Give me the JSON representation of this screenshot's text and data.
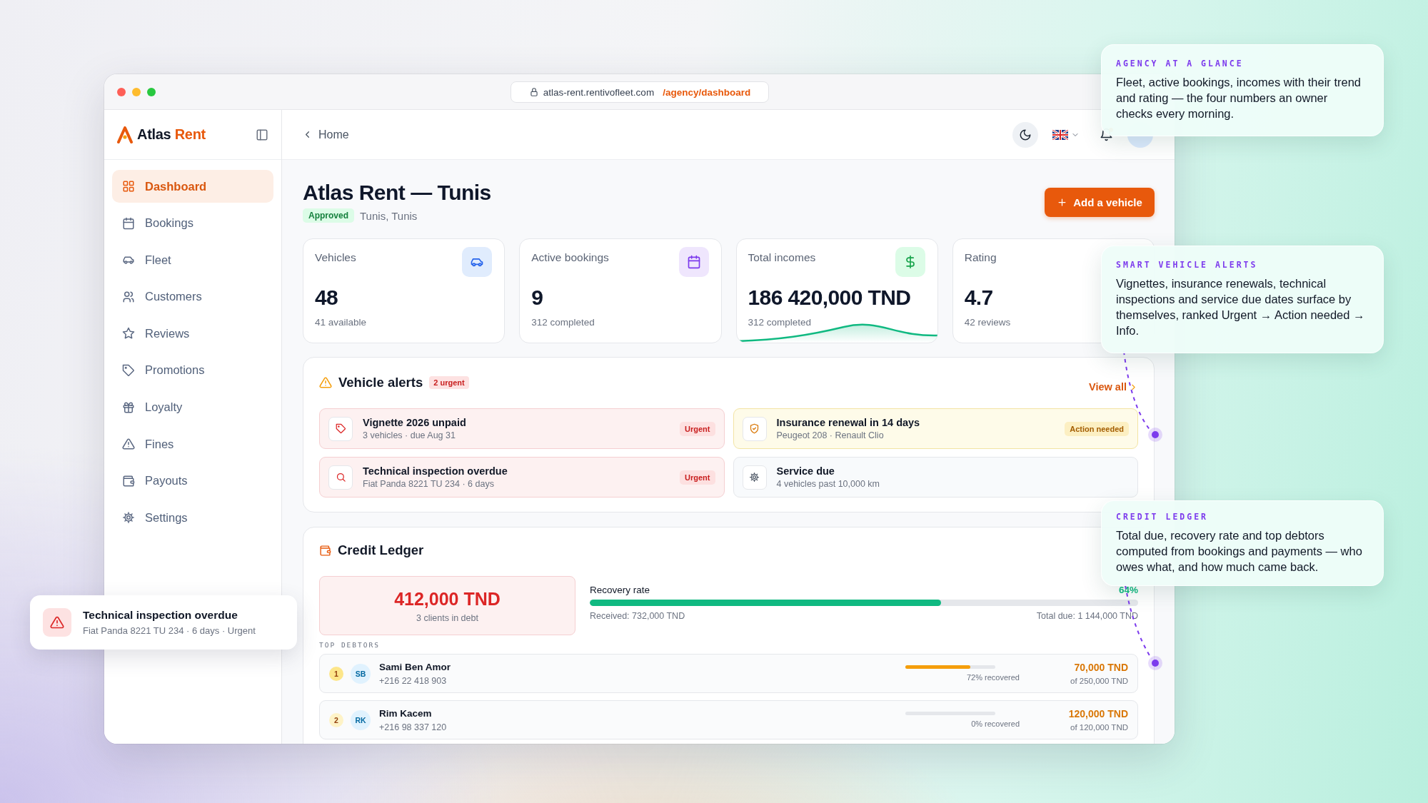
{
  "browser": {
    "url_host": "atlas-rent.rentivofleet.com",
    "url_path": "/agency/dashboard"
  },
  "sidebar": {
    "brand_first": "Atlas",
    "brand_second": "Rent",
    "items": [
      {
        "label": "Dashboard",
        "selected": true
      },
      {
        "label": "Bookings",
        "selected": false
      },
      {
        "label": "Fleet",
        "selected": false
      },
      {
        "label": "Customers",
        "selected": false
      },
      {
        "label": "Reviews",
        "selected": false
      },
      {
        "label": "Promotions",
        "selected": false
      },
      {
        "label": "Loyalty",
        "selected": false
      },
      {
        "label": "Fines",
        "selected": false
      },
      {
        "label": "Payouts",
        "selected": false
      },
      {
        "label": "Settings",
        "selected": false
      }
    ]
  },
  "header": {
    "back_label": "Home"
  },
  "page": {
    "title": "Atlas Rent — Tunis",
    "status": "Approved",
    "location": "Tunis, Tunis",
    "primary_action": "Add a vehicle"
  },
  "stats": [
    {
      "label": "Vehicles",
      "value": "48",
      "caption": "41 available",
      "kind": "plain"
    },
    {
      "label": "Active bookings",
      "value": "9",
      "caption": "312 completed",
      "kind": "plain"
    },
    {
      "label": "Total incomes",
      "value": "186 420,000 TND",
      "caption": "312 completed",
      "kind": "trend"
    },
    {
      "label": "Rating",
      "value": "4.7",
      "caption": "42 reviews",
      "kind": "plain"
    }
  ],
  "vehicle_alerts": {
    "title": "Vehicle alerts",
    "badge": "2 urgent",
    "view_all": "View all",
    "items": [
      {
        "title": "Vignette 2026 unpaid",
        "detail": "3 vehicles · due Aug 31",
        "kind": "urgent",
        "badge": "Urgent"
      },
      {
        "title": "Insurance renewal in 14 days",
        "detail": "Peugeot 208 · Renault Clio",
        "kind": "action",
        "badge": "Action needed"
      },
      {
        "title": "Technical inspection overdue",
        "detail": "Fiat Panda 8221 TU 234 · 6 days",
        "kind": "urgent",
        "badge": "Urgent"
      },
      {
        "title": "Service due",
        "detail": "4 vehicles past 10,000 km",
        "kind": "info"
      }
    ]
  },
  "credit_ledger": {
    "title": "Credit Ledger",
    "total": "412,000 TND",
    "total_caption": "3 clients in debt",
    "recovery": {
      "label": "Recovery rate",
      "value": "64%",
      "level": 0.64,
      "received": "Received: 732,000 TND",
      "total_due": "Total due: 1 144,000 TND"
    },
    "debtors_heading": "TOP DEBTORS",
    "debtors": [
      {
        "rank": "1",
        "initials": "SB",
        "name": "Sami Ben Amor",
        "phone": "+216 22 418 903",
        "level": 0.72,
        "recovered": "72% recovered",
        "amount": "70,000 TND",
        "of_total": "of 250,000 TND"
      },
      {
        "rank": "2",
        "initials": "RK",
        "name": "Rim Kacem",
        "phone": "+216 98 337 120",
        "level": 0,
        "recovered": "0% recovered",
        "amount": "120,000 TND",
        "of_total": "of 120,000 TND"
      }
    ]
  },
  "callouts": [
    {
      "label": "AGENCY AT A GLANCE",
      "text": "Fleet, active bookings, incomes with their trend and rating — the four numbers an owner checks every morning."
    },
    {
      "label": "SMART VEHICLE ALERTS",
      "text": "Vignettes, insurance renewals, technical inspections and service due dates surface by themselves, ranked Urgent → Action needed → Info."
    },
    {
      "label": "CREDIT LEDGER",
      "text": "Total due, recovery rate and top debtors computed from bookings and payments — who owes what, and how much came back."
    }
  ],
  "toast": {
    "title": "Technical inspection overdue",
    "detail": "Fiat Panda 8221 TU 234 · 6 days · Urgent"
  }
}
